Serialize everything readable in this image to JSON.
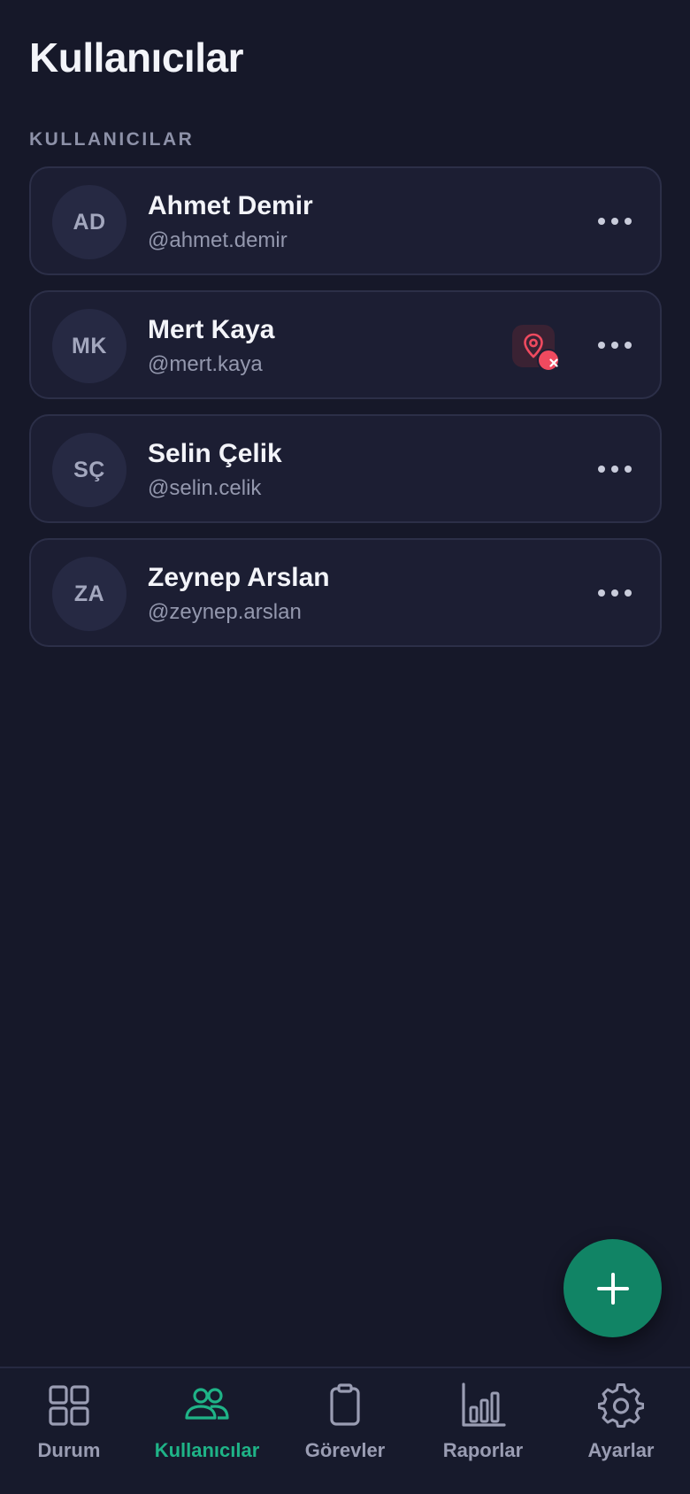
{
  "header": {
    "title": "Kullanıcılar"
  },
  "section": {
    "label": "KULLANICILAR"
  },
  "users": [
    {
      "initials": "AD",
      "name": "Ahmet Demir",
      "handle": "@ahmet.demir",
      "location_error": false
    },
    {
      "initials": "MK",
      "name": "Mert Kaya",
      "handle": "@mert.kaya",
      "location_error": true
    },
    {
      "initials": "SÇ",
      "name": "Selin Çelik",
      "handle": "@selin.celik",
      "location_error": false
    },
    {
      "initials": "ZA",
      "name": "Zeynep Arslan",
      "handle": "@zeynep.arslan",
      "location_error": false
    }
  ],
  "fab": {
    "icon": "plus-icon"
  },
  "nav": {
    "items": [
      {
        "label": "Durum",
        "icon": "grid-icon",
        "active": false
      },
      {
        "label": "Kullanıcılar",
        "icon": "users-icon",
        "active": true
      },
      {
        "label": "Görevler",
        "icon": "clipboard-icon",
        "active": false
      },
      {
        "label": "Raporlar",
        "icon": "bar-chart-icon",
        "active": false
      },
      {
        "label": "Ayarlar",
        "icon": "gear-icon",
        "active": false
      }
    ]
  },
  "colors": {
    "background": "#161829",
    "card": "#1c1e33",
    "accent": "#1fb387",
    "fab": "#118465",
    "error": "#ef4a5f"
  }
}
